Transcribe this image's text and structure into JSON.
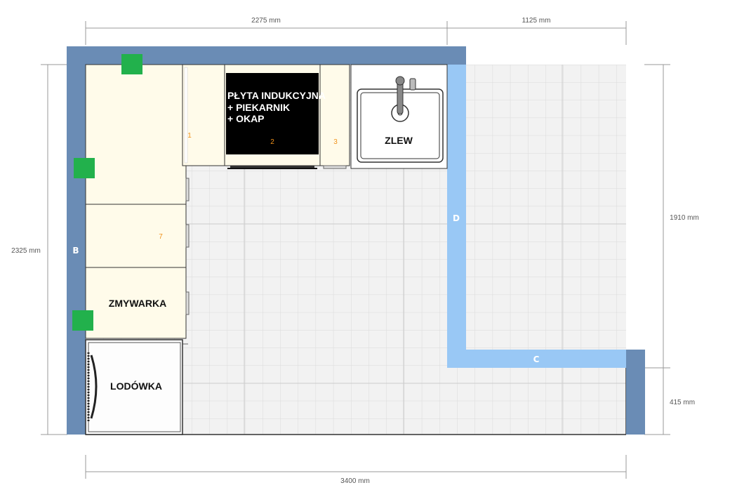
{
  "dimensions": {
    "top_left": "2275 mm",
    "top_right": "1125 mm",
    "left": "2325 mm",
    "right_upper": "1910 mm",
    "right_lower": "415 mm",
    "bottom": "3400 mm"
  },
  "walls": {
    "b": "B",
    "c": "C",
    "d": "D"
  },
  "cabinets": {
    "n1": "1",
    "n2": "2",
    "n3": "3",
    "n7": "7"
  },
  "appliances": {
    "cooktop_line1": "PŁYTA INDUKCYJNA",
    "cooktop_line2": "+ PIEKARNIK",
    "cooktop_line3": "+ OKAP",
    "sink": "ZLEW",
    "dishwasher": "ZMYWARKA",
    "fridge": "LODÓWKA"
  },
  "colors": {
    "outer_wall": "#6a8cb5",
    "inner_wall": "#99c8f5",
    "cabinet_fill": "#fffbea",
    "marker": "#22b14c",
    "number_label": "#f0921b"
  }
}
